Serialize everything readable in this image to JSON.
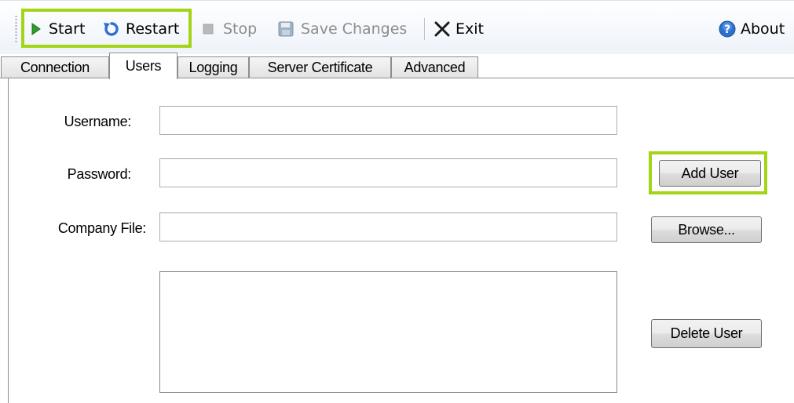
{
  "toolbar": {
    "start_label": "Start",
    "restart_label": "Restart",
    "stop_label": "Stop",
    "save_label": "Save Changes",
    "exit_label": "Exit",
    "about_label": "About"
  },
  "tabs": [
    {
      "label": "Connection",
      "active": false
    },
    {
      "label": "Users",
      "active": true
    },
    {
      "label": "Logging",
      "active": false
    },
    {
      "label": "Server Certificate",
      "active": false
    },
    {
      "label": "Advanced",
      "active": false
    }
  ],
  "form": {
    "username_label": "Username:",
    "username_value": "",
    "password_label": "Password:",
    "password_value": "",
    "company_file_label": "Company File:",
    "company_file_value": ""
  },
  "buttons": {
    "add_user": "Add User",
    "browse": "Browse...",
    "delete_user": "Delete User"
  },
  "users_list": [],
  "colors": {
    "highlight": "#a3d417",
    "start_icon": "#2e9b2e",
    "restart_icon": "#2f6fd1",
    "about_icon": "#2c6fcf",
    "disabled_text": "#8c8c8c"
  },
  "icons": {
    "start": "play-icon",
    "restart": "restart-icon",
    "stop": "stop-icon",
    "save": "save-disk-icon",
    "exit": "close-x-icon",
    "about": "help-icon"
  }
}
